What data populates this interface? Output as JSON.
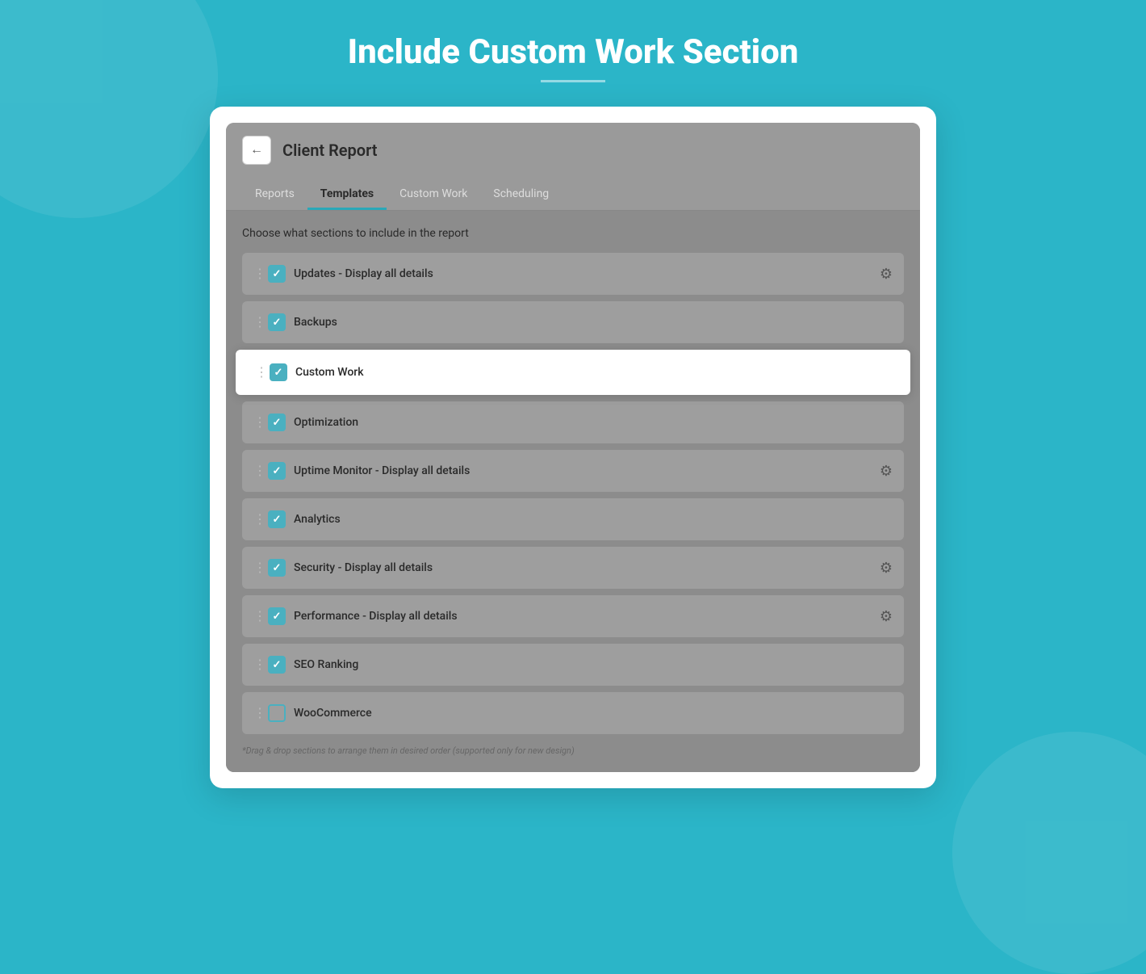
{
  "page": {
    "title": "Include Custom Work Section",
    "background_color": "#2bb5c8"
  },
  "panel": {
    "header": {
      "back_button_icon": "←",
      "title": "Client Report"
    },
    "tabs": [
      {
        "id": "reports",
        "label": "Reports",
        "active": false
      },
      {
        "id": "templates",
        "label": "Templates",
        "active": true
      },
      {
        "id": "custom-work",
        "label": "Custom Work",
        "active": false
      },
      {
        "id": "scheduling",
        "label": "Scheduling",
        "active": false
      }
    ],
    "content": {
      "section_label": "Choose what sections to include in the report",
      "checklist": [
        {
          "id": "updates",
          "label": "Updates - Display all details",
          "checked": true,
          "has_gear": true,
          "highlighted": false
        },
        {
          "id": "backups",
          "label": "Backups",
          "checked": true,
          "has_gear": false,
          "highlighted": false
        },
        {
          "id": "custom-work",
          "label": "Custom Work",
          "checked": true,
          "has_gear": false,
          "highlighted": true
        },
        {
          "id": "optimization",
          "label": "Optimization",
          "checked": true,
          "has_gear": false,
          "highlighted": false
        },
        {
          "id": "uptime",
          "label": "Uptime Monitor - Display all details",
          "checked": true,
          "has_gear": true,
          "highlighted": false
        },
        {
          "id": "analytics",
          "label": "Analytics",
          "checked": true,
          "has_gear": false,
          "highlighted": false
        },
        {
          "id": "security",
          "label": "Security - Display all details",
          "checked": true,
          "has_gear": true,
          "highlighted": false
        },
        {
          "id": "performance",
          "label": "Performance - Display all details",
          "checked": true,
          "has_gear": true,
          "highlighted": false
        },
        {
          "id": "seo",
          "label": "SEO Ranking",
          "checked": true,
          "has_gear": false,
          "highlighted": false
        },
        {
          "id": "woocommerce",
          "label": "WooCommerce",
          "checked": false,
          "has_gear": false,
          "highlighted": false
        }
      ],
      "footer_note": "*Drag & drop sections to arrange them in desired order (supported only for new design)"
    }
  }
}
